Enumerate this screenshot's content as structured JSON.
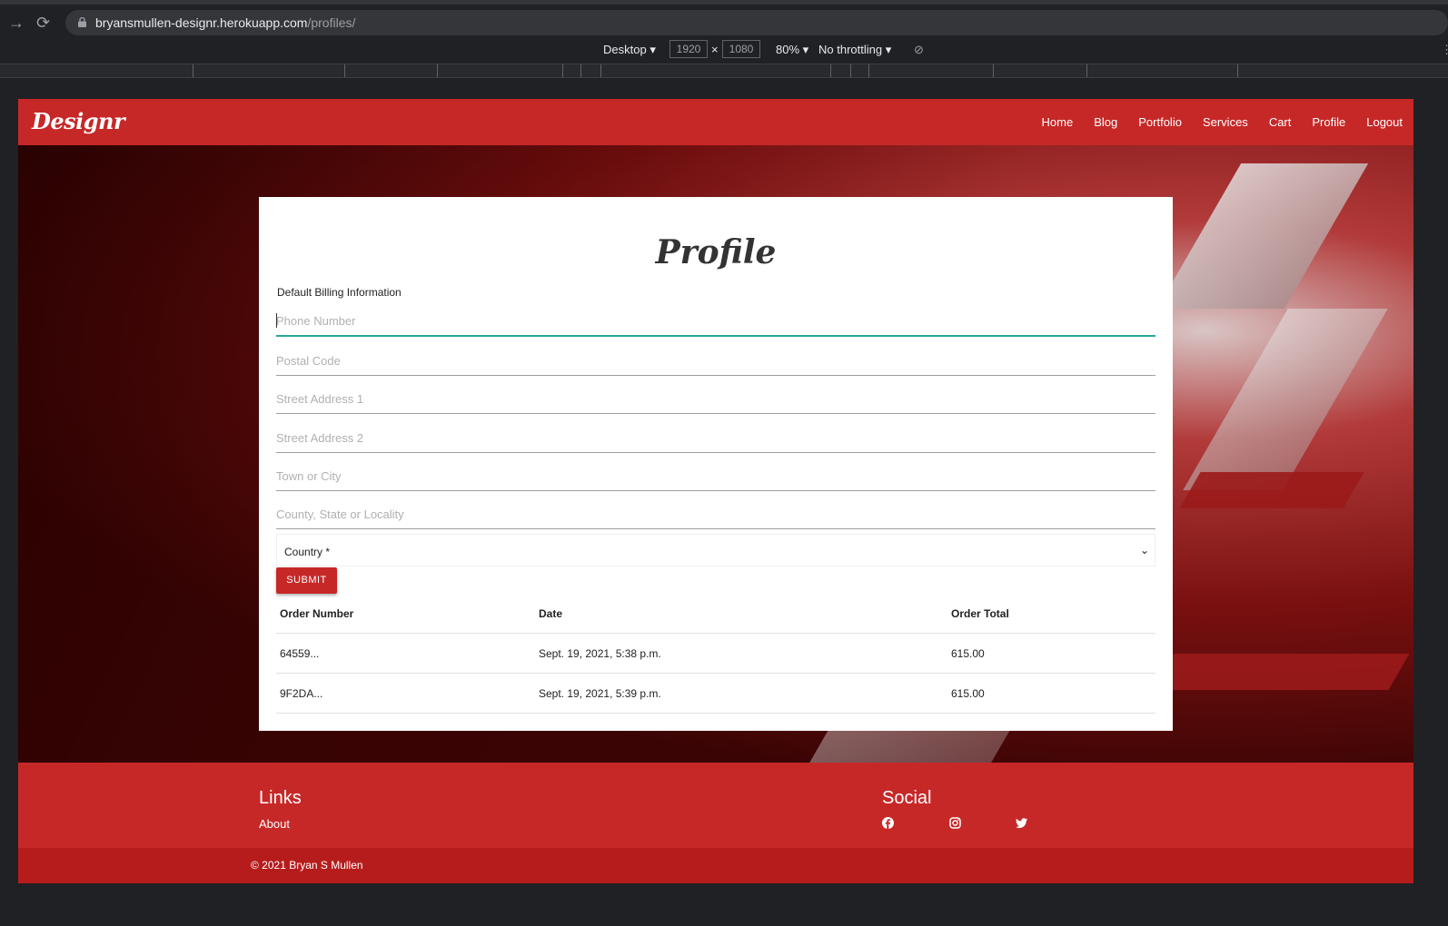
{
  "browser": {
    "url_host": "bryansmullen-designr.herokuapp.com",
    "url_path": "/profiles/",
    "device": "Desktop",
    "width": "1920",
    "height": "1080",
    "zoom": "80%",
    "throttling": "No throttling"
  },
  "site": {
    "logo": "Designr",
    "nav": [
      "Home",
      "Blog",
      "Portfolio",
      "Services",
      "Cart",
      "Profile",
      "Logout"
    ],
    "accent_color": "#c62828"
  },
  "profile": {
    "title": "Profile",
    "section_label": "Default Billing Information",
    "fields": [
      {
        "placeholder": "Phone Number",
        "value": ""
      },
      {
        "placeholder": "Postal Code",
        "value": ""
      },
      {
        "placeholder": "Street Address 1",
        "value": ""
      },
      {
        "placeholder": "Street Address 2",
        "value": ""
      },
      {
        "placeholder": "Town or City",
        "value": ""
      },
      {
        "placeholder": "County, State or Locality",
        "value": ""
      }
    ],
    "country_select": "Country *",
    "submit_label": "SUBMIT"
  },
  "orders": {
    "headers": [
      "Order Number",
      "Date",
      "Order Total"
    ],
    "rows": [
      [
        "64559...",
        "Sept. 19, 2021, 5:38 p.m.",
        "615.00"
      ],
      [
        "9F2DA...",
        "Sept. 19, 2021, 5:39 p.m.",
        "615.00"
      ]
    ]
  },
  "footer": {
    "links_heading": "Links",
    "links": [
      "About"
    ],
    "social_heading": "Social",
    "social_icons": [
      "facebook-icon",
      "instagram-icon",
      "twitter-icon"
    ],
    "copyright": "© 2021 Bryan S Mullen"
  }
}
